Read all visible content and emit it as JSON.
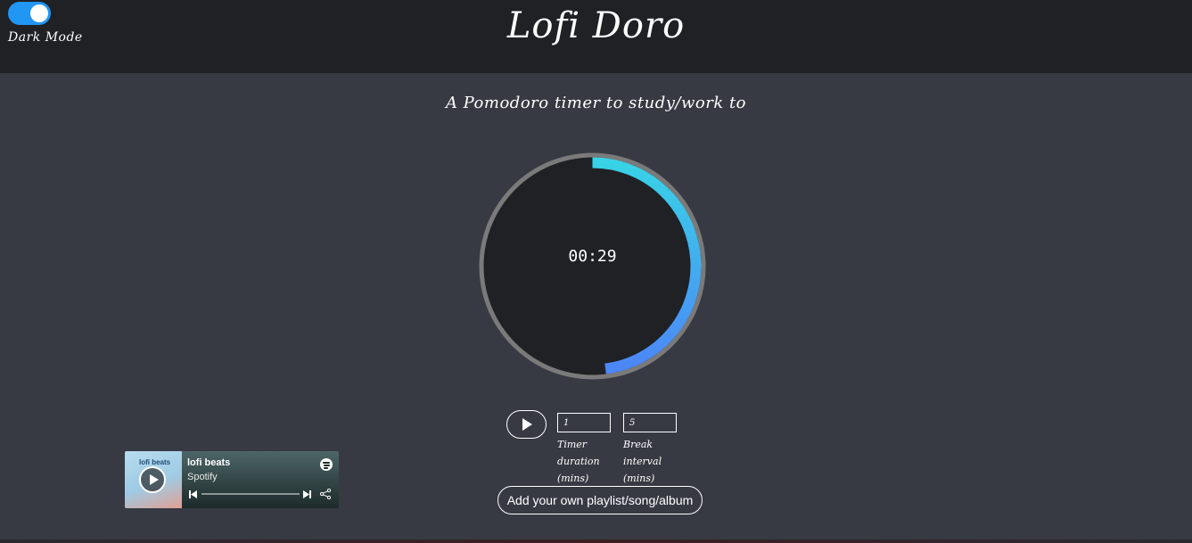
{
  "header": {
    "title": "Lofi Doro",
    "dark_mode_label": "Dark Mode",
    "dark_mode_on": true
  },
  "subtitle": "A Pomodoro timer to study/work to",
  "timer": {
    "display": "00:29",
    "progress_fraction": 0.48,
    "ring_color_start": "#38d3e6",
    "ring_color_end": "#4c86f7"
  },
  "controls": {
    "timer_duration_value": "1",
    "timer_duration_label": "Timer duration (mins)",
    "break_interval_value": "5",
    "break_interval_label": "Break interval (mins)",
    "add_playlist_label": "Add your own playlist/song/album"
  },
  "spotify": {
    "cover_text": "lofi beats",
    "title": "lofi beats",
    "subtitle": "Spotify"
  },
  "colors": {
    "accent": "#2196f3",
    "background": "#373a43",
    "header": "#202125"
  }
}
